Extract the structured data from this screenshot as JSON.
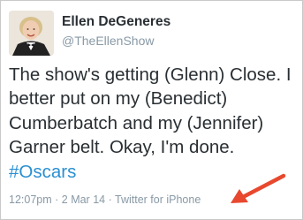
{
  "author": {
    "name": "Ellen DeGeneres",
    "handle": "@TheEllenShow"
  },
  "tweet": {
    "lines": [
      "The show's getting (Glenn) Close. I",
      "better put on my (Benedict)",
      "Cumberbatch and my (Jennifer)",
      "Garner belt. Okay, I'm done."
    ],
    "hashtag": "#Oscars"
  },
  "meta": {
    "time": "12:07pm",
    "separator_1": " · ",
    "date": "2 Mar 14",
    "separator_2": " · ",
    "source": "Twitter for iPhone"
  },
  "colors": {
    "hashtag": "#2a8fd1",
    "text": "#292f33",
    "muted": "#8899a6",
    "arrow": "#e8482e"
  },
  "icons": {
    "arrow": "arrow-pointing-left-icon"
  }
}
